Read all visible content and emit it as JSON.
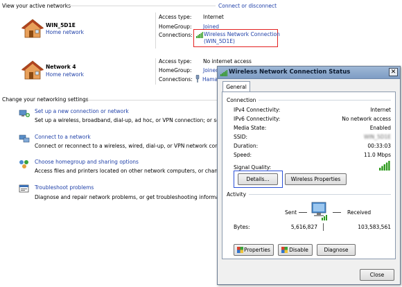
{
  "active_networks": {
    "header": "View your active networks",
    "right_link": "Connect or disconnect",
    "networks": [
      {
        "name": "WIN_5D1E",
        "type_link": "Home network",
        "access_type_label": "Access type:",
        "access_type_value": "Internet",
        "homegroup_label": "HomeGroup:",
        "homegroup_value": "Joined",
        "connections_label": "Connections:",
        "connection_name_line1": "Wireless Network Connection",
        "connection_name_line2": "(WIN_5D1E)"
      },
      {
        "name": "Network  4",
        "type_link": "Home network",
        "access_type_label": "Access type:",
        "access_type_value": "No internet access",
        "homegroup_label": "HomeGroup:",
        "homegroup_value": "Joined",
        "connections_label": "Connections:",
        "connection_name_line1": "Hamac"
      }
    ]
  },
  "settings": {
    "header": "Change your networking settings",
    "items": [
      {
        "title": "Set up a new connection or network",
        "desc": "Set up a wireless, broadband, dial-up, ad hoc, or VPN connection; or set up a r"
      },
      {
        "title": "Connect to a network",
        "desc": "Connect or reconnect to a wireless, wired, dial-up, or VPN network connectior"
      },
      {
        "title": "Choose homegroup and sharing options",
        "desc": "Access files and printers located on other network computers, or change shar"
      },
      {
        "title": "Troubleshoot problems",
        "desc": "Diagnose and repair network problems, or get troubleshooting information."
      }
    ]
  },
  "dialog": {
    "title": "Wireless Network Connection Status",
    "close_glyph": "✕",
    "tab": "General",
    "connection_group": "Connection",
    "rows": [
      {
        "label": "IPv4 Connectivity:",
        "value": "Internet"
      },
      {
        "label": "IPv6 Connectivity:",
        "value": "No network access"
      },
      {
        "label": "Media State:",
        "value": "Enabled"
      },
      {
        "label": "SSID:",
        "value": "WIN_5D1E"
      },
      {
        "label": "Duration:",
        "value": "00:33:03"
      },
      {
        "label": "Speed:",
        "value": "11.0 Mbps"
      }
    ],
    "signal_label": "Signal Quality:",
    "details_button": "Details...",
    "wireless_props_button": "Wireless Properties",
    "activity_group": "Activity",
    "sent_label": "Sent",
    "received_label": "Received",
    "bytes_label": "Bytes:",
    "bytes_sent": "5,616,827",
    "bytes_received": "103,583,561",
    "properties_button": "Properties",
    "disable_button": "Disable",
    "diagnose_button": "Diagnose",
    "close_button": "Close"
  },
  "colors": {
    "link": "#1e3fa8",
    "highlight_red": "#e32020",
    "highlight_blue": "#2a4fd6",
    "signal_green": "#2e9a1e"
  }
}
